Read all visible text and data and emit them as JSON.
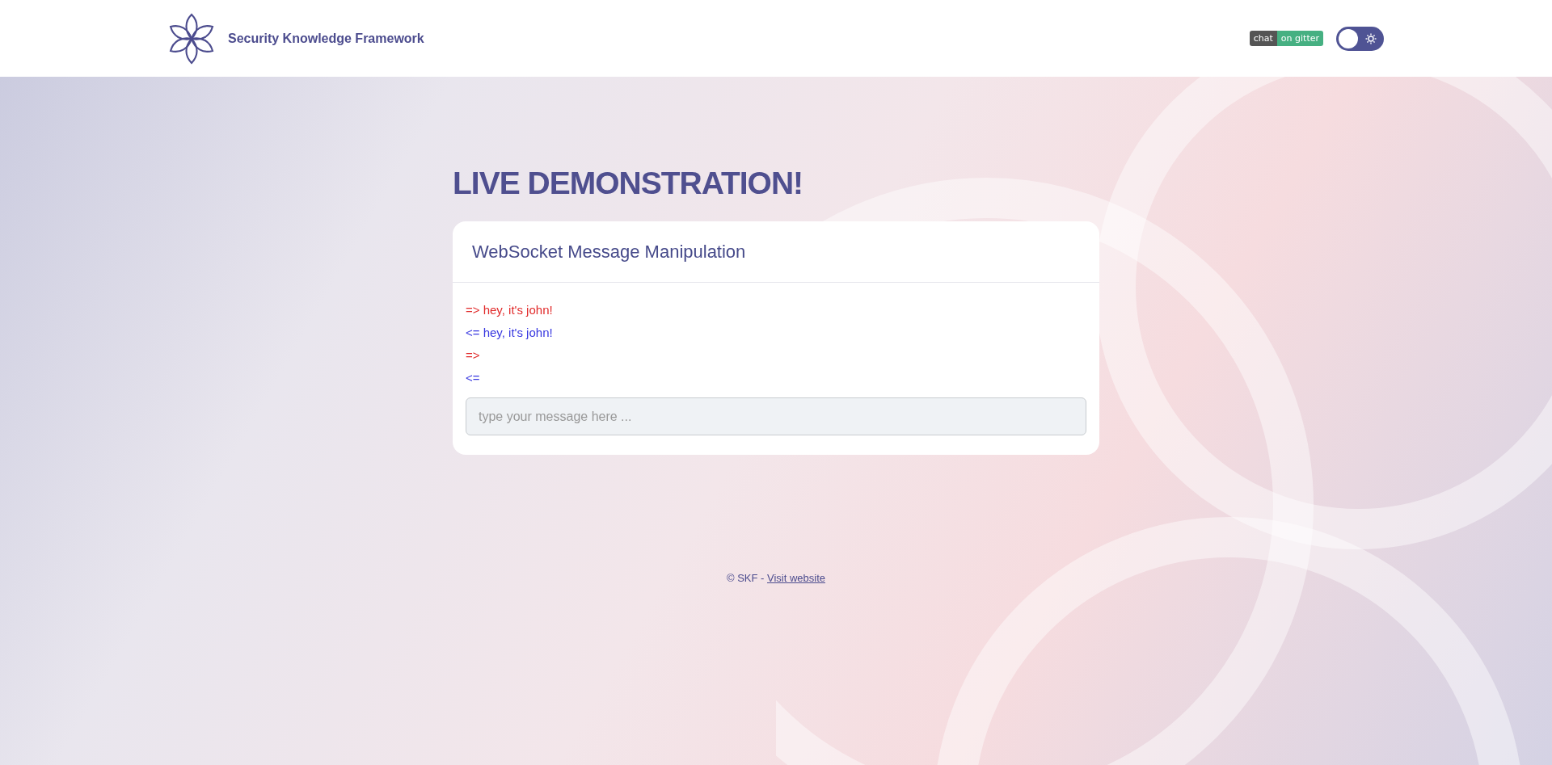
{
  "header": {
    "title": "Security Knowledge Framework",
    "badge": {
      "left": "chat",
      "right": "on gitter"
    },
    "theme_toggle": {
      "on": false
    }
  },
  "heading": "LIVE DEMONSTRATION!",
  "card": {
    "title": "WebSocket Message Manipulation",
    "messages": [
      {
        "kind": "sent",
        "text": "=> hey, it's john!"
      },
      {
        "kind": "received",
        "text": "<= hey, it's john!"
      },
      {
        "kind": "sent",
        "text": "=>"
      },
      {
        "kind": "received",
        "text": "<="
      }
    ],
    "input": {
      "placeholder": "type your message here ..."
    }
  },
  "footer": {
    "text": "© SKF -",
    "link": "Visit website"
  }
}
